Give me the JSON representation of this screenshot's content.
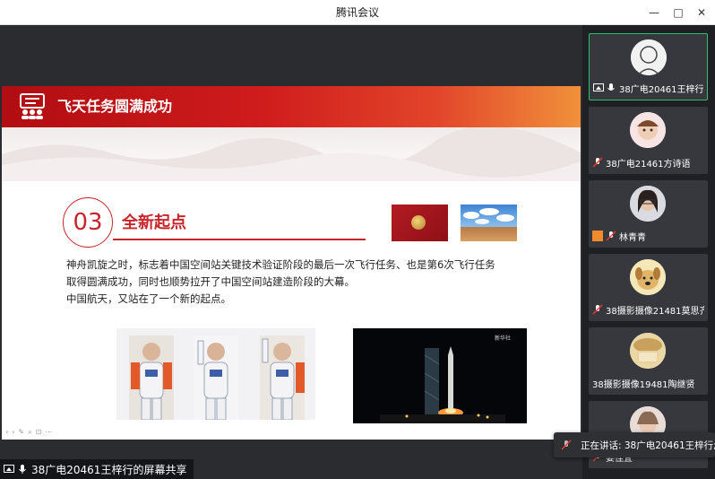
{
  "window": {
    "title": "腾讯会议",
    "minimize_glyph": "—",
    "maximize_glyph": "□",
    "close_glyph": "✕"
  },
  "slide": {
    "banner_title": "飞天任务圆满成功",
    "section_number": "03",
    "section_title": "全新起点",
    "paragraphs": [
      "神舟凯旋之时，标志着中国空间站关键技术验证阶段的最后一次飞行任务、也是第6次飞行任务",
      "取得圆满成功，同时也顺势拉开了中国空间站建造阶段的大幕。",
      "中国航天，又站在了一个新的起点。"
    ],
    "photo_caption": "新华社",
    "toolbar_glyphs": "‹›✎⌕⊡⋯"
  },
  "share": {
    "label": "38广电20461王梓行的屏幕共享"
  },
  "participants": [
    {
      "name": "38广电20461王梓行...",
      "active": true,
      "icon": "screen-share-icon",
      "mic": "mic-on-icon"
    },
    {
      "name": "38广电21461方诗语",
      "active": false,
      "mic": "mic-muted-icon"
    },
    {
      "name": "林青青",
      "active": false,
      "icon": "user-badge-icon",
      "mic": "mic-muted-icon"
    },
    {
      "name": "38摄影摄像21481莫思齐",
      "active": false,
      "mic": "mic-muted-icon"
    },
    {
      "name": "38摄影摄像19481陶继贤",
      "active": false
    },
    {
      "name": "姜佳宜",
      "active": false,
      "mic": "mic-muted-icon"
    }
  ],
  "speaking": {
    "text": "正在讲话: 38广电20461王梓行;..."
  },
  "colors": {
    "accent_red": "#c7252a",
    "active_border": "#2fbf71",
    "panel_bg": "#1f2023"
  }
}
